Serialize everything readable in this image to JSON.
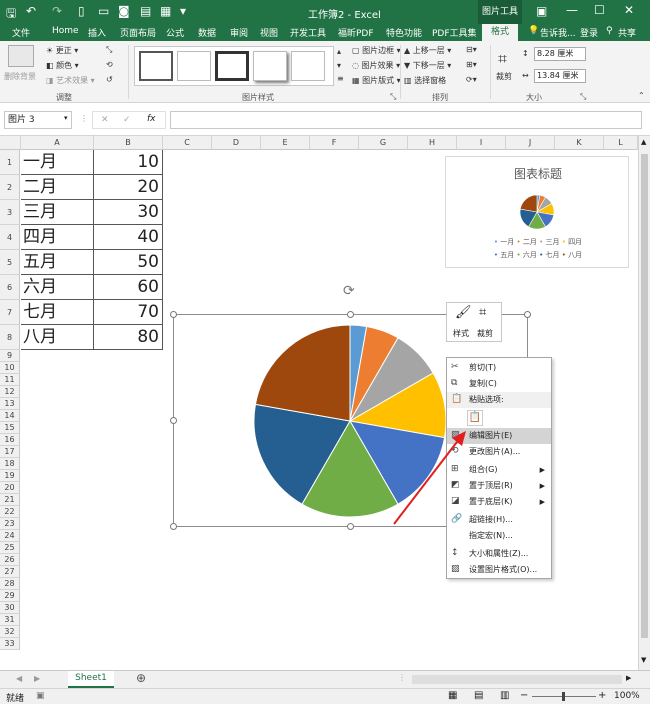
{
  "title_bar": {
    "doc_title": "工作簿2 - Excel",
    "context_tab": "图片工具"
  },
  "ribbon_tabs": [
    "文件",
    "Home",
    "插入",
    "页面布局",
    "公式",
    "数据",
    "审阅",
    "视图",
    "开发工具",
    "福昕PDF",
    "特色功能",
    "PDF工具集",
    "格式"
  ],
  "tell_me": "告诉我...",
  "login": "登录",
  "share": "共享",
  "ribbon": {
    "adjust": {
      "remove_bg": "删除背景",
      "corrections": "更正",
      "color": "颜色",
      "artistic": "艺术效果",
      "label": "调整"
    },
    "styles": {
      "border": "图片边框",
      "effects": "图片效果",
      "layout": "图片版式",
      "label": "图片样式"
    },
    "arrange": {
      "forward": "上移一层",
      "backward": "下移一层",
      "pane": "选择窗格",
      "label": "排列"
    },
    "size": {
      "crop": "裁剪",
      "height": "8.28 厘米",
      "width": "13.84 厘米",
      "label": "大小"
    }
  },
  "name_box": "图片 3",
  "columns": [
    "A",
    "B",
    "C",
    "D",
    "E",
    "F",
    "G",
    "H",
    "I",
    "J",
    "K",
    "L"
  ],
  "rows": [
    "1",
    "2",
    "3",
    "4",
    "5",
    "6",
    "7",
    "8",
    "9",
    "10",
    "11",
    "12",
    "13",
    "14",
    "15",
    "16",
    "17",
    "18",
    "19",
    "20",
    "21",
    "22",
    "23",
    "24",
    "25",
    "26",
    "27",
    "28",
    "29",
    "30",
    "31",
    "32",
    "33"
  ],
  "table": [
    [
      "一月",
      "10"
    ],
    [
      "二月",
      "20"
    ],
    [
      "三月",
      "30"
    ],
    [
      "四月",
      "40"
    ],
    [
      "五月",
      "50"
    ],
    [
      "六月",
      "60"
    ],
    [
      "七月",
      "70"
    ],
    [
      "八月",
      "80"
    ]
  ],
  "small_chart": {
    "title": "图表标题",
    "legend": [
      "一月",
      "二月",
      "三月",
      "四月",
      "五月",
      "六月",
      "七月",
      "八月"
    ]
  },
  "colors": [
    "#5b9bd5",
    "#ed7d31",
    "#a5a5a5",
    "#ffc000",
    "#4472c4",
    "#70ad47",
    "#255e91",
    "#9e480e"
  ],
  "mini_toolbar": {
    "style": "样式",
    "crop": "裁剪"
  },
  "context_menu": {
    "cut": "剪切(T)",
    "copy": "复制(C)",
    "paste_options": "粘贴选项:",
    "edit_picture": "编辑图片(E)",
    "change_picture": "更改图片(A)...",
    "group": "组合(G)",
    "bring_front": "置于顶层(R)",
    "send_back": "置于底层(K)",
    "hyperlink": "超链接(H)...",
    "assign_macro": "指定宏(N)...",
    "size_props": "大小和属性(Z)...",
    "format_picture": "设置图片格式(O)..."
  },
  "sheet_tab": "Sheet1",
  "status": {
    "ready": "就绪",
    "zoom": "100%"
  }
}
